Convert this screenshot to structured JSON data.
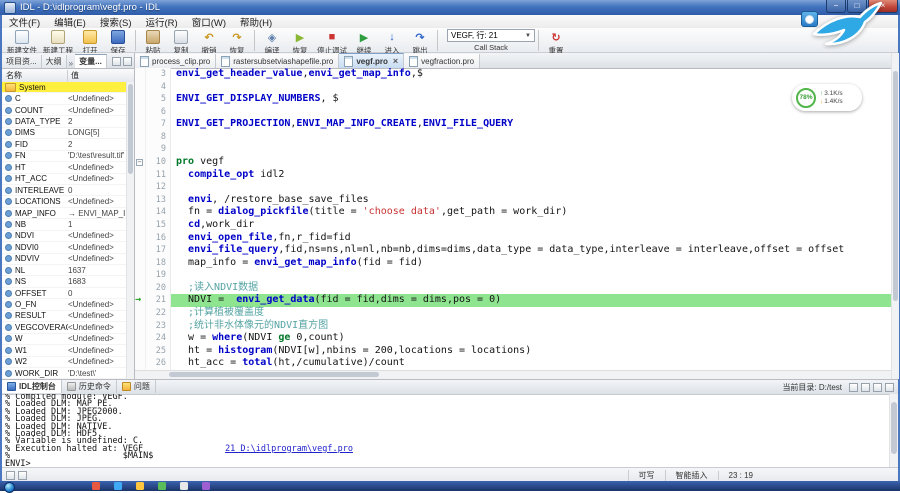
{
  "titlebar": {
    "title": "IDL - D:\\idlprogram\\vegf.pro - IDL",
    "minimize": "−",
    "maximize": "□",
    "close": "×"
  },
  "menubar": {
    "items": [
      "文件(F)",
      "编辑(E)",
      "搜索(S)",
      "运行(R)",
      "窗口(W)",
      "帮助(H)"
    ]
  },
  "toolbar": {
    "groups": [
      {
        "buttons": [
          {
            "id": "new-file",
            "label": "新建文件"
          },
          {
            "id": "new-project",
            "label": "新建工程"
          },
          {
            "id": "open",
            "label": "打开"
          },
          {
            "id": "save",
            "label": "保存"
          }
        ]
      },
      {
        "buttons": [
          {
            "id": "paste",
            "label": "粘贴"
          },
          {
            "id": "copy",
            "label": "复制"
          },
          {
            "id": "undo",
            "label": "撤销"
          },
          {
            "id": "redo",
            "label": "恢复"
          }
        ]
      },
      {
        "buttons": [
          {
            "id": "compile",
            "label": "编译"
          },
          {
            "id": "resume",
            "label": "恢复"
          },
          {
            "id": "stop",
            "label": "停止调试"
          },
          {
            "id": "continue",
            "label": "继续"
          },
          {
            "id": "step-into",
            "label": "进入"
          },
          {
            "id": "step-out",
            "label": "跳出"
          }
        ]
      }
    ],
    "callstack": {
      "value": "VEGF, 行: 21",
      "label": "Call Stack"
    },
    "reset_label": "重置"
  },
  "left_panel": {
    "tabs": [
      {
        "label": "项目资...",
        "active": false
      },
      {
        "label": "大纲",
        "active": false
      },
      {
        "label": "变量...",
        "active": true
      }
    ],
    "columns": {
      "name": "名称",
      "value": "值"
    },
    "rows": [
      {
        "name": "System",
        "value": "",
        "system": true
      },
      {
        "name": "C",
        "value": "<Undefined>"
      },
      {
        "name": "COUNT",
        "value": "<Undefined>"
      },
      {
        "name": "DATA_TYPE",
        "value": "2"
      },
      {
        "name": "DIMS",
        "value": "LONG[5]"
      },
      {
        "name": "FID",
        "value": "2"
      },
      {
        "name": "FN",
        "value": "'D:\\test\\result.tif'"
      },
      {
        "name": "HT",
        "value": "<Undefined>"
      },
      {
        "name": "HT_ACC",
        "value": "<Undefined>"
      },
      {
        "name": "INTERLEAVE",
        "value": "0"
      },
      {
        "name": "LOCATIONS",
        "value": "<Undefined>"
      },
      {
        "name": "MAP_INFO",
        "value": "→ ENVI_MAP_INFO..."
      },
      {
        "name": "NB",
        "value": "1"
      },
      {
        "name": "NDVI",
        "value": "<Undefined>"
      },
      {
        "name": "NDVI0",
        "value": "<Undefined>"
      },
      {
        "name": "NDVIV",
        "value": "<Undefined>"
      },
      {
        "name": "NL",
        "value": "1637"
      },
      {
        "name": "NS",
        "value": "1683"
      },
      {
        "name": "OFFSET",
        "value": "0"
      },
      {
        "name": "O_FN",
        "value": "<Undefined>"
      },
      {
        "name": "RESULT",
        "value": "<Undefined>"
      },
      {
        "name": "VEGCOVERAGE",
        "value": "<Undefined>"
      },
      {
        "name": "W",
        "value": "<Undefined>"
      },
      {
        "name": "W1",
        "value": "<Undefined>"
      },
      {
        "name": "W2",
        "value": "<Undefined>"
      },
      {
        "name": "WORK_DIR",
        "value": "'D:\\test\\'"
      }
    ]
  },
  "editor": {
    "tabs": [
      {
        "label": "process_clip.pro",
        "active": false
      },
      {
        "label": "rastersubsetviashapefile.pro",
        "active": false
      },
      {
        "label": "vegf.pro",
        "active": true
      },
      {
        "label": "vegfraction.pro",
        "active": false
      }
    ],
    "lines": [
      {
        "n": 3,
        "segs": [
          [
            "b",
            "envi_get_header_value"
          ],
          [
            "t",
            ","
          ],
          [
            "b",
            "envi_get_map_info"
          ],
          [
            "t",
            ",$"
          ]
        ]
      },
      {
        "n": 4,
        "segs": []
      },
      {
        "n": 5,
        "segs": [
          [
            "b",
            "ENVI_GET_DISPLAY_NUMBERS"
          ],
          [
            "t",
            ", $"
          ]
        ]
      },
      {
        "n": 6,
        "segs": []
      },
      {
        "n": 7,
        "segs": [
          [
            "b",
            "ENVI_GET_PROJECTION"
          ],
          [
            "t",
            ","
          ],
          [
            "b",
            "ENVI_MAP_INFO_CREATE"
          ],
          [
            "t",
            ","
          ],
          [
            "b",
            "ENVI_FILE_QUERY"
          ]
        ]
      },
      {
        "n": 8,
        "segs": []
      },
      {
        "n": 9,
        "segs": []
      },
      {
        "n": 10,
        "fold": true,
        "segs": [
          [
            "k",
            "pro"
          ],
          [
            "t",
            " vegf"
          ]
        ]
      },
      {
        "n": 11,
        "segs": [
          [
            "t",
            "  "
          ],
          [
            "b",
            "compile_opt"
          ],
          [
            "t",
            " idl2"
          ]
        ]
      },
      {
        "n": 12,
        "segs": []
      },
      {
        "n": 13,
        "segs": [
          [
            "t",
            "  "
          ],
          [
            "b",
            "envi"
          ],
          [
            "t",
            ", /restore_base_save_files"
          ]
        ]
      },
      {
        "n": 14,
        "segs": [
          [
            "t",
            "  fn = "
          ],
          [
            "b",
            "dialog_pickfile"
          ],
          [
            "t",
            "(title = "
          ],
          [
            "s",
            "'choose data'"
          ],
          [
            "t",
            ",get_path = work_dir)"
          ]
        ]
      },
      {
        "n": 15,
        "segs": [
          [
            "t",
            "  "
          ],
          [
            "b",
            "cd"
          ],
          [
            "t",
            ",work_dir"
          ]
        ]
      },
      {
        "n": 16,
        "segs": [
          [
            "t",
            "  "
          ],
          [
            "b",
            "envi_open_file"
          ],
          [
            "t",
            ",fn,r_fid=fid"
          ]
        ]
      },
      {
        "n": 17,
        "segs": [
          [
            "t",
            "  "
          ],
          [
            "b",
            "envi_file_query"
          ],
          [
            "t",
            ",fid,ns=ns,nl=nl,nb=nb,dims=dims,data_type = data_type,interleave = interleave,offset = offset"
          ]
        ]
      },
      {
        "n": 18,
        "segs": [
          [
            "t",
            "  map_info = "
          ],
          [
            "b",
            "envi_get_map_info"
          ],
          [
            "t",
            "(fid = fid)"
          ]
        ]
      },
      {
        "n": 19,
        "segs": []
      },
      {
        "n": 20,
        "segs": [
          [
            "c",
            "  ;读入NDVI数据"
          ]
        ]
      },
      {
        "n": 21,
        "current": true,
        "marker": true,
        "segs": [
          [
            "t",
            "  NDVI =  "
          ],
          [
            "b",
            "envi_get_data"
          ],
          [
            "t",
            "(fid = fid,dims = dims,pos = 0)"
          ]
        ]
      },
      {
        "n": 22,
        "segs": [
          [
            "c",
            "  ;计算植被覆盖度"
          ]
        ]
      },
      {
        "n": 23,
        "segs": [
          [
            "c",
            "  ;统计非水体像元的NDVI直方图"
          ]
        ]
      },
      {
        "n": 24,
        "segs": [
          [
            "t",
            "  w = "
          ],
          [
            "b",
            "where"
          ],
          [
            "t",
            "(NDVI "
          ],
          [
            "k",
            "ge"
          ],
          [
            "t",
            " 0,count)"
          ]
        ]
      },
      {
        "n": 25,
        "segs": [
          [
            "t",
            "  ht = "
          ],
          [
            "b",
            "histogram"
          ],
          [
            "t",
            "(NDVI[w],nbins = 200,locations = locations)"
          ]
        ]
      },
      {
        "n": 26,
        "segs": [
          [
            "t",
            "  ht_acc = "
          ],
          [
            "b",
            "total"
          ],
          [
            "t",
            "(ht,/cumulative)/count"
          ]
        ]
      }
    ]
  },
  "console": {
    "tabs": [
      {
        "label": "IDL控制台",
        "active": true
      },
      {
        "label": "历史命令",
        "active": false
      },
      {
        "label": "问题",
        "active": false
      }
    ],
    "current_dir": "当前目录: D:/test",
    "lines": [
      {
        "segs": [
          [
            "t",
            "% Compiled module: VEGF."
          ]
        ]
      },
      {
        "segs": [
          [
            "t",
            "% Loaded DLM: MAP_PE."
          ]
        ]
      },
      {
        "segs": [
          [
            "t",
            "% Loaded DLM: JPEG2000."
          ]
        ]
      },
      {
        "segs": [
          [
            "t",
            "% Loaded DLM: JPEG."
          ]
        ]
      },
      {
        "segs": [
          [
            "t",
            "% Loaded DLM: NATIVE."
          ]
        ]
      },
      {
        "segs": [
          [
            "t",
            "% Loaded DLM: HDF5."
          ]
        ]
      },
      {
        "segs": [
          [
            "t",
            "% Variable is undefined: C."
          ]
        ]
      },
      {
        "segs": [
          [
            "t",
            "% Execution halted at: VEGF                "
          ],
          [
            "lnk",
            "21 D:\\idlprogram\\vegf.pro"
          ]
        ]
      },
      {
        "segs": [
          [
            "t",
            "%                      $MAIN$"
          ]
        ]
      },
      {
        "segs": [
          [
            "t",
            "ENVI>"
          ]
        ]
      }
    ]
  },
  "statusbar": {
    "items": [
      "可写",
      "智能插入",
      "23 : 19"
    ]
  },
  "overlay": {
    "percent": "78%",
    "up_speed": "3.1K/s",
    "down_speed": "1.4K/s"
  },
  "taskbar": {
    "icons": [
      {
        "id": "taskbar-app-1",
        "color": "#E8573F"
      },
      {
        "id": "taskbar-app-2",
        "color": "#3FA9F5"
      },
      {
        "id": "taskbar-app-3",
        "color": "#FFC73E"
      },
      {
        "id": "taskbar-app-4",
        "color": "#58BD5A"
      },
      {
        "id": "taskbar-app-5",
        "color": "#E8E8E8"
      },
      {
        "id": "taskbar-app-6",
        "color": "#9E5FD0"
      }
    ]
  }
}
